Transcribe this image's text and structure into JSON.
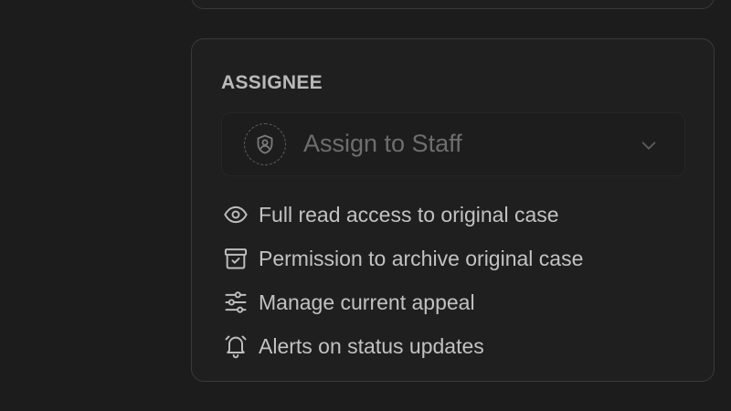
{
  "assignee": {
    "title": "ASSIGNEE",
    "placeholder": "Assign to Staff",
    "avatar_icon": "shield-user-icon",
    "dropdown_icon": "chevron-down-icon"
  },
  "permissions": [
    {
      "icon": "eye-icon",
      "label": "Full read access to original case"
    },
    {
      "icon": "archive-icon",
      "label": "Permission to archive original case"
    },
    {
      "icon": "sliders-icon",
      "label": "Manage current appeal"
    },
    {
      "icon": "bell-icon",
      "label": "Alerts on status updates"
    }
  ],
  "colors": {
    "background": "#1c1c1c",
    "card": "#1f1f1f",
    "border": "#3a3a3a",
    "title": "#b9b9b9",
    "placeholder": "#6e6e6e",
    "text": "#c2c2c2",
    "icon": "#bdbdbd"
  }
}
